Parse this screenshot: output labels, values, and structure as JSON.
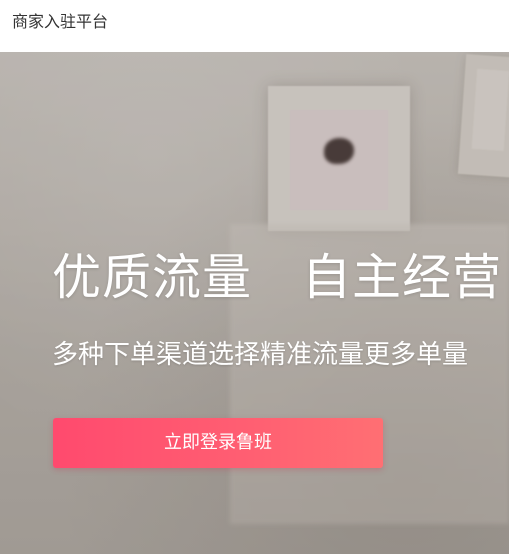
{
  "header": {
    "title": "商家入驻平台"
  },
  "hero": {
    "headline": "优质流量　自主经营",
    "subline": "多种下单渠道选择精准流量更多单量",
    "cta_label": "立即登录鲁班"
  },
  "colors": {
    "cta_start": "#ff4a6e",
    "cta_end": "#ff6f73",
    "header_text": "#333333",
    "hero_text": "#ffffff"
  }
}
